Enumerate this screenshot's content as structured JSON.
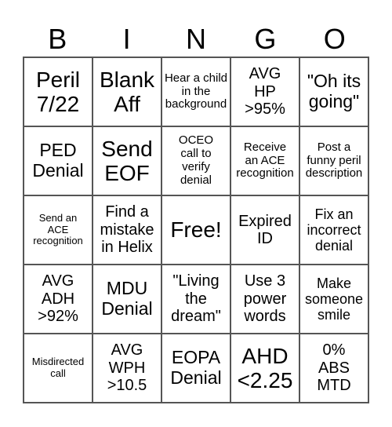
{
  "header": [
    "B",
    "I",
    "N",
    "G",
    "O"
  ],
  "cells": [
    {
      "text": "Peril\n7/22",
      "size": "s6"
    },
    {
      "text": "Blank\nAff",
      "size": "s6"
    },
    {
      "text": "Hear a child\nin the\nbackground",
      "size": "s2"
    },
    {
      "text": "AVG\nHP\n>95%",
      "size": "s4"
    },
    {
      "text": "\"Oh its\ngoing\"",
      "size": "s5"
    },
    {
      "text": "PED\nDenial",
      "size": "s5"
    },
    {
      "text": "Send\nEOF",
      "size": "s6"
    },
    {
      "text": "OCEO\ncall to\nverify\ndenial",
      "size": "s2"
    },
    {
      "text": "Receive\nan ACE\nrecognition",
      "size": "s2"
    },
    {
      "text": "Post a\nfunny peril\ndescription",
      "size": "s2"
    },
    {
      "text": "Send an\nACE\nrecognition",
      "size": "s1"
    },
    {
      "text": "Find a\nmistake\nin Helix",
      "size": "s4"
    },
    {
      "text": "Free!",
      "size": "s6"
    },
    {
      "text": "Expired\nID",
      "size": "s4"
    },
    {
      "text": "Fix an\nincorrect\ndenial",
      "size": "s3"
    },
    {
      "text": "AVG\nADH\n>92%",
      "size": "s4"
    },
    {
      "text": "MDU\nDenial",
      "size": "s5"
    },
    {
      "text": "\"Living\nthe\ndream\"",
      "size": "s4"
    },
    {
      "text": "Use 3\npower\nwords",
      "size": "s4"
    },
    {
      "text": "Make\nsomeone\nsmile",
      "size": "s3"
    },
    {
      "text": "Misdirected\ncall",
      "size": "s1"
    },
    {
      "text": "AVG\nWPH\n>10.5",
      "size": "s4"
    },
    {
      "text": "EOPA\nDenial",
      "size": "s5"
    },
    {
      "text": "AHD\n<2.25",
      "size": "s6"
    },
    {
      "text": "0%\nABS\nMTD",
      "size": "s4"
    }
  ]
}
